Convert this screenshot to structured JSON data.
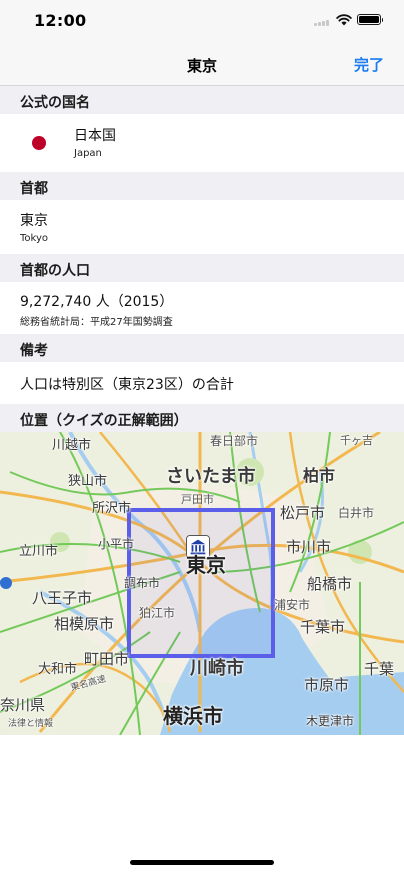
{
  "status_bar": {
    "time": "12:00"
  },
  "nav": {
    "title": "東京",
    "done_label": "完了"
  },
  "sections": {
    "country": {
      "header": "公式の国名",
      "name": "日本国",
      "name_en": "Japan"
    },
    "capital": {
      "header": "首都",
      "name": "東京",
      "name_en": "Tokyo"
    },
    "population": {
      "header": "首都の人口",
      "value": "9,272,740 人（2015）",
      "source": "総務省統計局：平成27年国勢調査"
    },
    "notes": {
      "header": "備考",
      "text": "人口は特別区（東京23区）の合計"
    },
    "location": {
      "header": "位置（クイズの正解範囲）"
    }
  },
  "map": {
    "labels": {
      "kawagoe": "川越市",
      "saitama": "さいたま市",
      "kasukabe": "春日部市",
      "noda": "千ヶ吉",
      "sayama": "狭山市",
      "kashiwa": "柏市",
      "tokorozawa": "所沢市",
      "toda": "戸田市",
      "matsudo": "松戸市",
      "shiroi": "白井市",
      "tachikawa": "立川市",
      "kodaira": "小平市",
      "tokyo": "東京",
      "ichikawa": "市川市",
      "hachioji": "八王子市",
      "chofu": "調布市",
      "funabashi": "船橋市",
      "sagamihara": "相模原市",
      "komae": "狛江市",
      "urayasu": "浦安市",
      "chiba": "千葉市",
      "yamato": "大和市",
      "machida": "町田市",
      "kawasaki": "川崎市",
      "ichihara": "市原市",
      "kanagawa": "奈川県",
      "yokohama": "横浜市",
      "kisarazu": "木更津市",
      "chiba_east": "千葉",
      "tomei": "東名高速",
      "attribution": "法律と情報"
    },
    "colors": {
      "region": "#5b5ee8",
      "water": "#a4cdf0",
      "expressway": "#f2b84f",
      "road": "#73c95a"
    }
  },
  "colors": {
    "accent": "#1c7cf2",
    "flag_red": "#be0029",
    "section_bg": "#efeff4"
  }
}
